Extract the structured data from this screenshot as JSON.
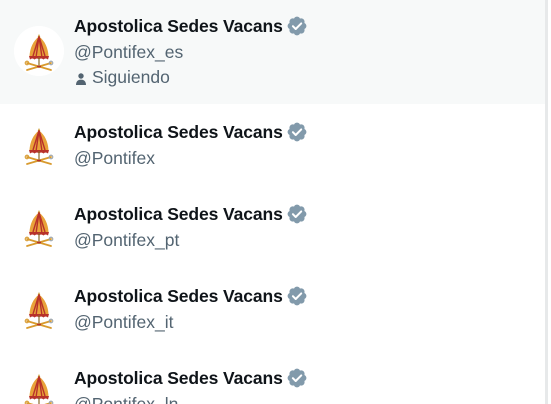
{
  "accounts": [
    {
      "name": "Apostolica Sedes Vacans",
      "handle": "@Pontifex_es",
      "status": "Siguiendo",
      "verified": true,
      "avatar_icon": "papal-emblem-icon"
    },
    {
      "name": "Apostolica Sedes Vacans",
      "handle": "@Pontifex",
      "verified": true,
      "avatar_icon": "papal-emblem-icon"
    },
    {
      "name": "Apostolica Sedes Vacans",
      "handle": "@Pontifex_pt",
      "verified": true,
      "avatar_icon": "papal-emblem-icon"
    },
    {
      "name": "Apostolica Sedes Vacans",
      "handle": "@Pontifex_it",
      "verified": true,
      "avatar_icon": "papal-emblem-icon"
    },
    {
      "name": "Apostolica Sedes Vacans",
      "handle": "@Pontifex_ln",
      "verified": true,
      "avatar_icon": "papal-emblem-icon"
    }
  ],
  "colors": {
    "name_text": "#0f1419",
    "secondary_text": "#536471",
    "verified_badge": "#829aab",
    "highlight_bg": "#f7f9f9",
    "emblem_gold": "#e8a23a",
    "emblem_red": "#b8312a"
  }
}
